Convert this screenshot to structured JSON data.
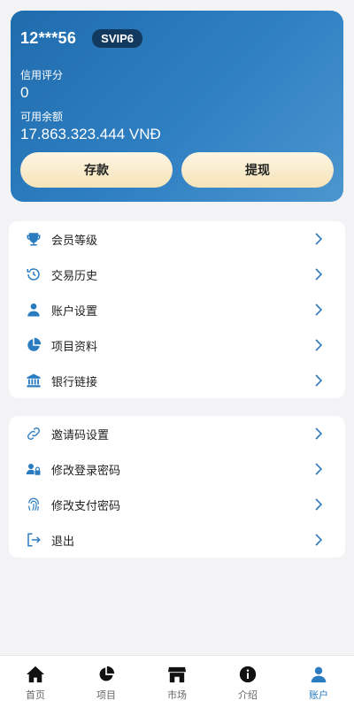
{
  "account": {
    "username": "12***56",
    "vip_level": "SVIP6",
    "credit_label": "信用评分",
    "credit_value": "0",
    "balance_label": "可用余额",
    "balance_value": "17.863.323.444 VNĐ",
    "deposit_label": "存款",
    "withdraw_label": "提现"
  },
  "menu_group_1": [
    {
      "label": "会员等级",
      "icon": "trophy-icon"
    },
    {
      "label": "交易历史",
      "icon": "history-icon"
    },
    {
      "label": "账户设置",
      "icon": "user-icon"
    },
    {
      "label": "项目资料",
      "icon": "pie-chart-icon"
    },
    {
      "label": "银行链接",
      "icon": "bank-icon"
    }
  ],
  "menu_group_2": [
    {
      "label": "邀请码设置",
      "icon": "link-icon"
    },
    {
      "label": "修改登录密码",
      "icon": "user-lock-icon"
    },
    {
      "label": "修改支付密码",
      "icon": "fingerprint-icon"
    },
    {
      "label": "退出",
      "icon": "logout-icon"
    }
  ],
  "tabbar": [
    {
      "label": "首页",
      "icon": "home-icon",
      "active": false
    },
    {
      "label": "项目",
      "icon": "pie-chart-icon",
      "active": false
    },
    {
      "label": "市场",
      "icon": "store-icon",
      "active": false
    },
    {
      "label": "介绍",
      "icon": "info-icon",
      "active": false
    },
    {
      "label": "账户",
      "icon": "user-icon",
      "active": true
    }
  ],
  "colors": {
    "accent": "#2b7bc0",
    "card_gradient_start": "#1f6cad",
    "card_gradient_end": "#4c95cf",
    "button_gold": "#f6e3b8",
    "badge_bg": "#123a5e"
  }
}
